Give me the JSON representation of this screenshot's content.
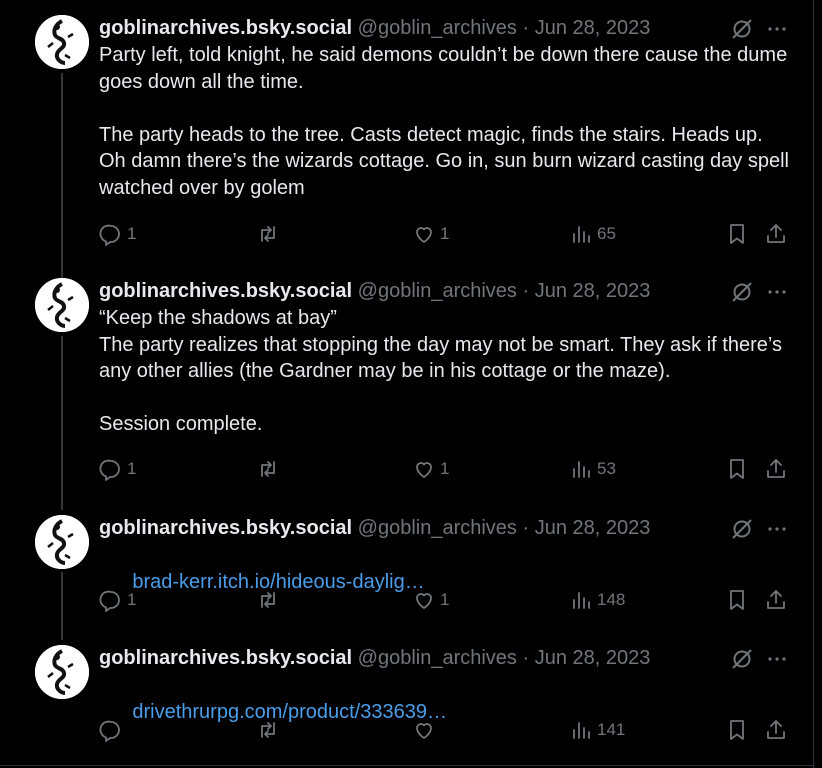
{
  "tweets": [
    {
      "name": "goblinarchives.bsky.social",
      "handle": "@goblin_archives",
      "dot": "·",
      "date": "Jun 28, 2023",
      "text": "Party left, told knight, he said demons couldn’t be down there cause the dume goes down all the time.\n\nThe party heads to the tree. Casts detect magic, finds the stairs. Heads up. Oh damn there’s the wizards cottage. Go in, sun burn wizard casting day spell watched over by golem",
      "link": "",
      "replies": "1",
      "reposts": "",
      "likes": "1",
      "views": "65"
    },
    {
      "name": "goblinarchives.bsky.social",
      "handle": "@goblin_archives",
      "dot": "·",
      "date": "Jun 28, 2023",
      "text": "“Keep the shadows at bay”\nThe party realizes that stopping the day may not be smart. They ask if there’s any other allies (the Gardner may be in his cottage or the maze).\n\nSession complete.",
      "link": "",
      "replies": "1",
      "reposts": "",
      "likes": "1",
      "views": "53"
    },
    {
      "name": "goblinarchives.bsky.social",
      "handle": "@goblin_archives",
      "dot": "·",
      "date": "Jun 28, 2023",
      "text": "",
      "link": "brad-kerr.itch.io/hideous-daylig…",
      "replies": "1",
      "reposts": "",
      "likes": "1",
      "views": "148"
    },
    {
      "name": "goblinarchives.bsky.social",
      "handle": "@goblin_archives",
      "dot": "·",
      "date": "Jun 28, 2023",
      "text": "",
      "link": "drivethrurpg.com/product/333639…",
      "replies": "",
      "reposts": "",
      "likes": "",
      "views": "141"
    }
  ],
  "icons": {
    "reply": "reply-icon",
    "repost": "repost-icon",
    "like": "heart-icon",
    "views": "views-icon",
    "bookmark": "bookmark-icon",
    "share": "share-icon",
    "grok": "grok-icon",
    "more": "more-icon"
  },
  "colors": {
    "background": "#000000",
    "text": "#e7e9ea",
    "muted": "#71767b",
    "link": "#4a9de8"
  }
}
